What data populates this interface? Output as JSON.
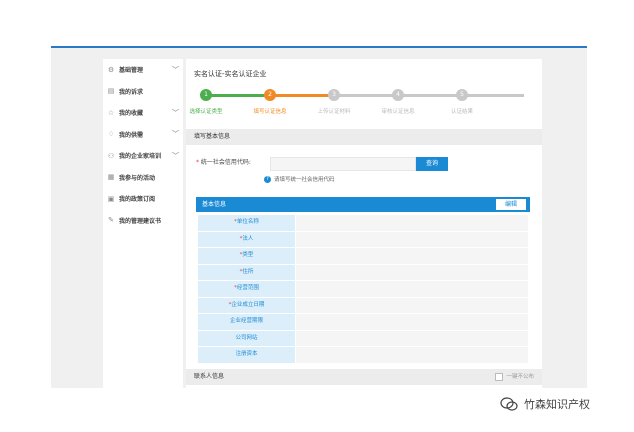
{
  "sidebar": {
    "items": [
      {
        "label": "基础管理",
        "icon": "gear-icon",
        "glyph": "⚙",
        "has_chevron": true
      },
      {
        "label": "我的诉求",
        "icon": "document-icon",
        "glyph": "▤",
        "has_chevron": false
      },
      {
        "label": "我的收藏",
        "icon": "star-icon",
        "glyph": "☆",
        "has_chevron": true
      },
      {
        "label": "我的供需",
        "icon": "bell-icon",
        "glyph": "♢",
        "has_chevron": true
      },
      {
        "label": "我的企业家培训",
        "icon": "training-icon",
        "glyph": "⚇",
        "has_chevron": true
      },
      {
        "label": "我参与的活动",
        "icon": "calendar-icon",
        "glyph": "▦",
        "has_chevron": false
      },
      {
        "label": "我的政策订阅",
        "icon": "subscribe-icon",
        "glyph": "▣",
        "has_chevron": false
      },
      {
        "label": "我的管理建议书",
        "icon": "edit-icon",
        "glyph": "✎",
        "has_chevron": false
      }
    ]
  },
  "main": {
    "title": "实名认证-实名认证企业",
    "steps": [
      {
        "num": "1",
        "label": "选择认证类型",
        "state": "done"
      },
      {
        "num": "2",
        "label": "填写认证信息",
        "state": "active"
      },
      {
        "num": "3",
        "label": "上传认证材料",
        "state": "todo"
      },
      {
        "num": "4",
        "label": "审核认证信息",
        "state": "todo"
      },
      {
        "num": "5",
        "label": "认证结果",
        "state": "todo"
      }
    ],
    "section_basic_fill": "填写基本信息",
    "credit_label_req": "*",
    "credit_label": "统一社会信用代码:",
    "credit_value": "",
    "query_button": "查询",
    "hint_icon": "?",
    "hint_text": "请填写统一社会信用代码",
    "basic_info_title": "基本信息",
    "edit_button": "编辑",
    "fields": [
      {
        "label": "单位名称",
        "required": true,
        "value": ""
      },
      {
        "label": "法人",
        "required": true,
        "value": ""
      },
      {
        "label": "类型",
        "required": true,
        "value": ""
      },
      {
        "label": "住所",
        "required": true,
        "value": ""
      },
      {
        "label": "经营范围",
        "required": true,
        "value": ""
      },
      {
        "label": "企业成立日期",
        "required": true,
        "value": ""
      },
      {
        "label": "企业经营期限",
        "required": false,
        "value": ""
      },
      {
        "label": "公司网站",
        "required": false,
        "value": ""
      },
      {
        "label": "注册资本",
        "required": false,
        "value": ""
      }
    ],
    "contact_title": "联系人信息",
    "no_disclose": "一键不公布"
  },
  "watermark": {
    "text": "竹森知识产权"
  },
  "colors": {
    "done": "#4cae4c",
    "active": "#f08a24",
    "todo": "#c8c8c8",
    "accent": "#1a8ad4"
  }
}
